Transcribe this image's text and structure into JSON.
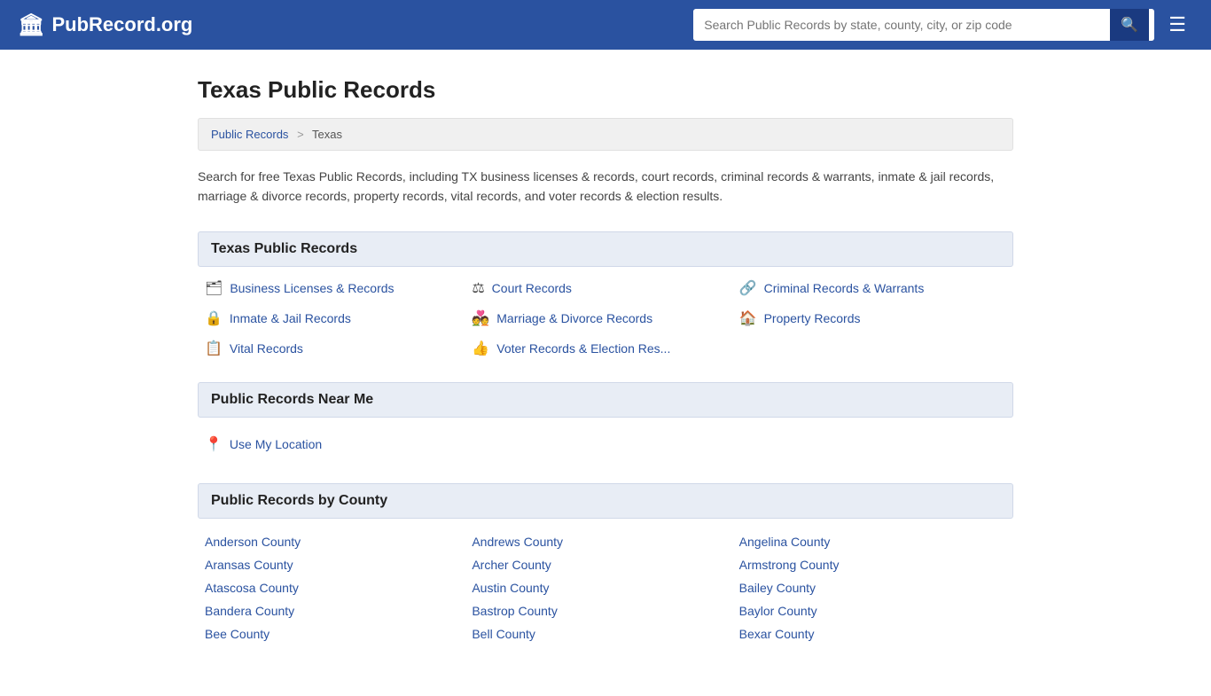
{
  "header": {
    "logo_icon": "🏛",
    "logo_text": "PubRecord.org",
    "search_placeholder": "Search Public Records by state, county, city, or zip code",
    "search_btn_icon": "🔍",
    "menu_icon": "☰"
  },
  "page": {
    "title": "Texas Public Records",
    "breadcrumb": {
      "parent_label": "Public Records",
      "separator": ">",
      "current": "Texas"
    },
    "description": "Search for free Texas Public Records, including TX business licenses & records, court records, criminal records & warrants, inmate & jail records, marriage & divorce records, property records, vital records, and voter records & election results."
  },
  "texas_records_section": {
    "heading": "Texas Public Records",
    "items": [
      {
        "icon": "🗂",
        "label": "Business Licenses & Records"
      },
      {
        "icon": "⚖",
        "label": "Court Records"
      },
      {
        "icon": "🔗",
        "label": "Criminal Records & Warrants"
      },
      {
        "icon": "🔒",
        "label": "Inmate & Jail Records"
      },
      {
        "icon": "💑",
        "label": "Marriage & Divorce Records"
      },
      {
        "icon": "🏠",
        "label": "Property Records"
      },
      {
        "icon": "📋",
        "label": "Vital Records"
      },
      {
        "icon": "👍",
        "label": "Voter Records & Election Res..."
      }
    ]
  },
  "near_me_section": {
    "heading": "Public Records Near Me",
    "location_label": "Use My Location",
    "location_icon": "📍"
  },
  "county_section": {
    "heading": "Public Records by County",
    "counties": [
      "Anderson County",
      "Andrews County",
      "Angelina County",
      "Aransas County",
      "Archer County",
      "Armstrong County",
      "Atascosa County",
      "Austin County",
      "Bailey County",
      "Bandera County",
      "Bastrop County",
      "Baylor County",
      "Bee County",
      "Bell County",
      "Bexar County"
    ]
  }
}
